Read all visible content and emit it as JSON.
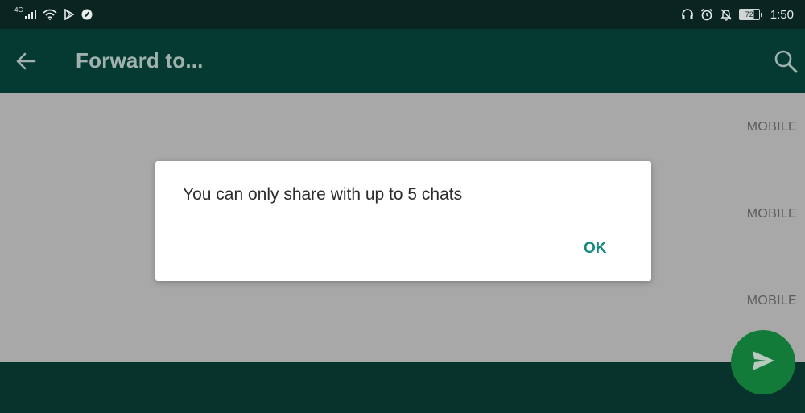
{
  "status_bar": {
    "network_type": "4G",
    "battery_level": "72",
    "time": "1:50",
    "icons": [
      "signal-icon",
      "wifi-icon",
      "play-store-icon",
      "location-icon",
      "headphones-icon",
      "alarm-icon",
      "notifications-muted-icon",
      "battery-icon"
    ]
  },
  "app_bar": {
    "title": "Forward to...",
    "back_icon": "arrow-back-icon",
    "search_icon": "search-icon"
  },
  "contacts": [
    {
      "type": "MOBILE"
    },
    {
      "type": "MOBILE"
    },
    {
      "type": "MOBILE"
    }
  ],
  "dialog": {
    "message": "You can only share with up to 5 chats",
    "ok_label": "OK"
  },
  "fab": {
    "icon": "send-icon"
  },
  "colors": {
    "status_bar": "#0a2521",
    "app_bar": "#053a32",
    "overlay": "#a8a8a8",
    "fab": "#127b3a",
    "accent": "#148a7e"
  }
}
